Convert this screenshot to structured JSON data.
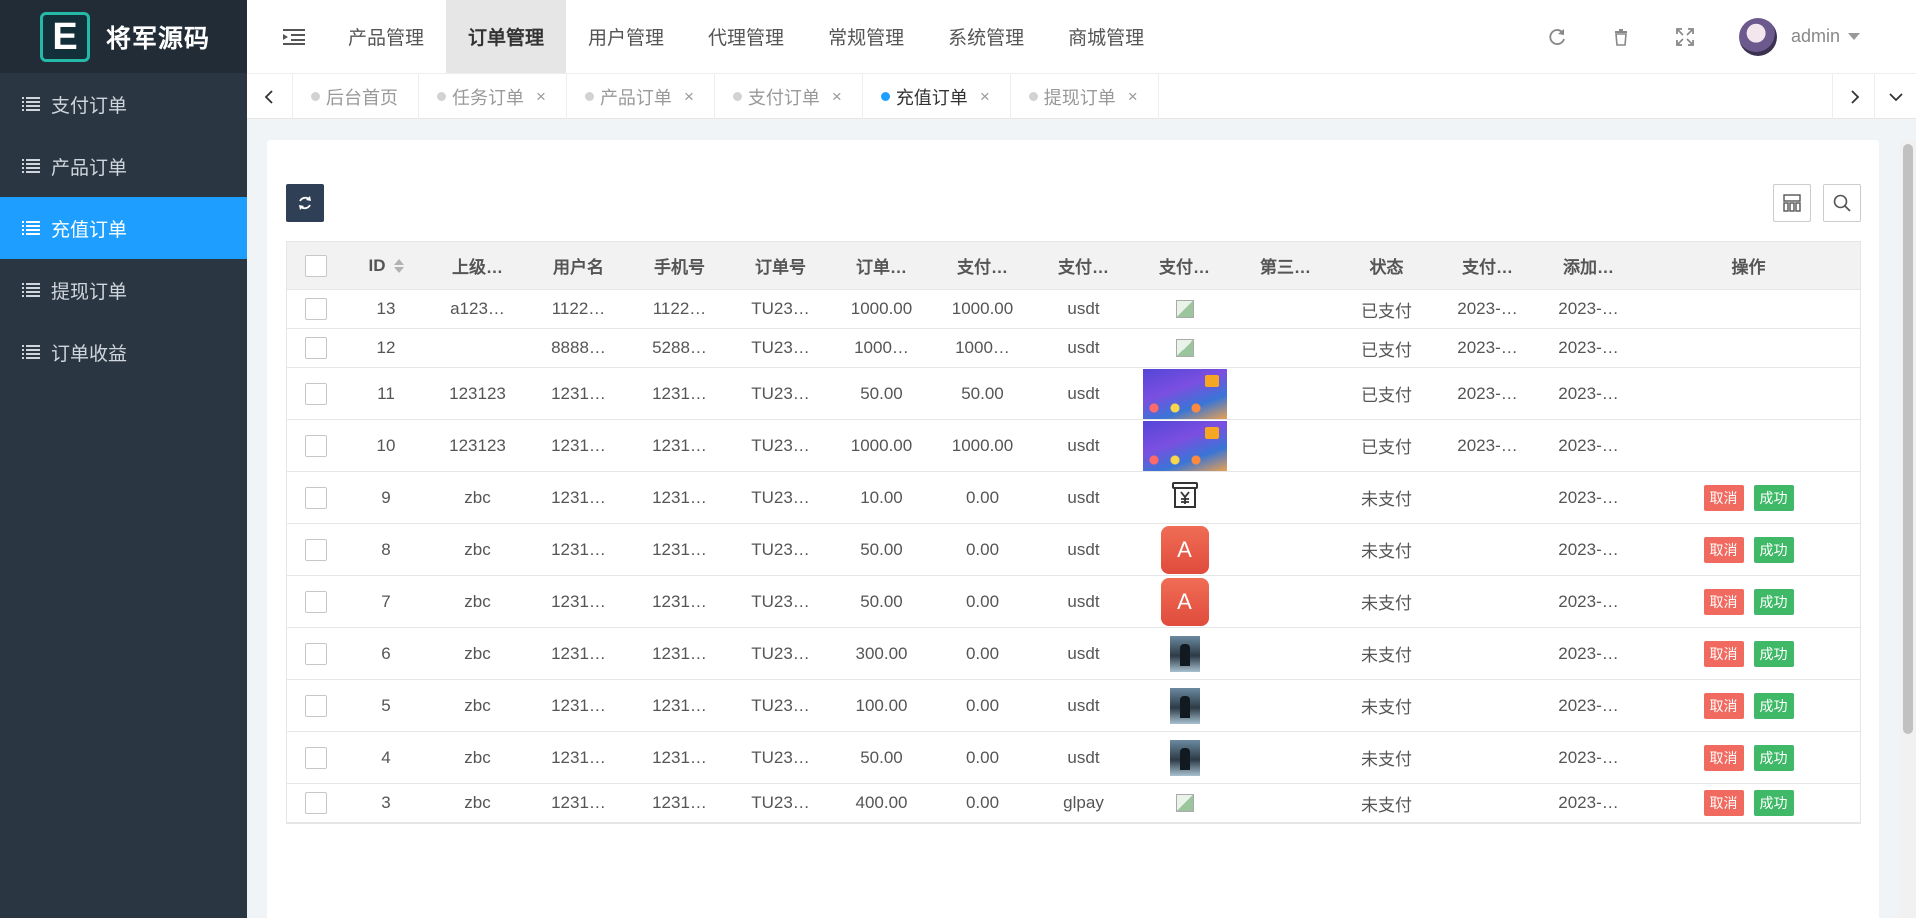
{
  "brand": {
    "letter": "E",
    "name": "将军源码"
  },
  "sidebar": {
    "items": [
      {
        "label": "支付订单",
        "active": false
      },
      {
        "label": "产品订单",
        "active": false
      },
      {
        "label": "充值订单",
        "active": true
      },
      {
        "label": "提现订单",
        "active": false
      },
      {
        "label": "订单收益",
        "active": false
      }
    ]
  },
  "topnav": {
    "items": [
      {
        "label": "产品管理",
        "active": false
      },
      {
        "label": "订单管理",
        "active": true
      },
      {
        "label": "用户管理",
        "active": false
      },
      {
        "label": "代理管理",
        "active": false
      },
      {
        "label": "常规管理",
        "active": false
      },
      {
        "label": "系统管理",
        "active": false
      },
      {
        "label": "商城管理",
        "active": false
      }
    ],
    "username": "admin",
    "tools": [
      "refresh-icon",
      "trash-icon",
      "fullscreen-icon"
    ]
  },
  "tabs": [
    {
      "label": "后台首页",
      "closable": false,
      "active": false
    },
    {
      "label": "任务订单",
      "closable": true,
      "active": false
    },
    {
      "label": "产品订单",
      "closable": true,
      "active": false
    },
    {
      "label": "支付订单",
      "closable": true,
      "active": false
    },
    {
      "label": "充值订单",
      "closable": true,
      "active": true
    },
    {
      "label": "提现订单",
      "closable": true,
      "active": false
    }
  ],
  "table": {
    "headers": {
      "id": "ID",
      "parent": "上级…",
      "user": "用户名",
      "phone": "手机号",
      "order": "订单号",
      "amount": "订单…",
      "paid": "支付…",
      "paytype": "支付…",
      "image": "支付…",
      "third": "第三…",
      "status": "状态",
      "paytime": "支付…",
      "addtime": "添加…",
      "ops": "操作"
    },
    "actions": {
      "cancel": "取消",
      "success": "成功"
    },
    "rows": [
      {
        "id": "13",
        "parent": "a123…",
        "user": "1122…",
        "phone": "1122…",
        "order": "TU23…",
        "amount": "1000.00",
        "paid": "1000.00",
        "paytype": "usdt",
        "thumb": "broken",
        "third": "",
        "status": "已支付",
        "paytime": "2023-…",
        "addtime": "2023-…",
        "ops": false
      },
      {
        "id": "12",
        "parent": "",
        "user": "8888…",
        "phone": "5288…",
        "order": "TU23…",
        "amount": "1000…",
        "paid": "1000…",
        "paytype": "usdt",
        "thumb": "broken",
        "third": "",
        "status": "已支付",
        "paytime": "2023-…",
        "addtime": "2023-…",
        "ops": false
      },
      {
        "id": "11",
        "parent": "123123",
        "user": "1231…",
        "phone": "1231…",
        "order": "TU23…",
        "amount": "50.00",
        "paid": "50.00",
        "paytype": "usdt",
        "thumb": "banner",
        "third": "",
        "status": "已支付",
        "paytime": "2023-…",
        "addtime": "2023-…",
        "ops": false
      },
      {
        "id": "10",
        "parent": "123123",
        "user": "1231…",
        "phone": "1231…",
        "order": "TU23…",
        "amount": "1000.00",
        "paid": "1000.00",
        "paytype": "usdt",
        "thumb": "banner",
        "third": "",
        "status": "已支付",
        "paytime": "2023-…",
        "addtime": "2023-…",
        "ops": false
      },
      {
        "id": "9",
        "parent": "zbc",
        "user": "1231…",
        "phone": "1231…",
        "order": "TU23…",
        "amount": "10.00",
        "paid": "0.00",
        "paytype": "usdt",
        "thumb": "yen",
        "third": "",
        "status": "未支付",
        "paytime": "",
        "addtime": "2023-…",
        "ops": true
      },
      {
        "id": "8",
        "parent": "zbc",
        "user": "1231…",
        "phone": "1231…",
        "order": "TU23…",
        "amount": "50.00",
        "paid": "0.00",
        "paytype": "usdt",
        "thumb": "appA",
        "third": "",
        "status": "未支付",
        "paytime": "",
        "addtime": "2023-…",
        "ops": true
      },
      {
        "id": "7",
        "parent": "zbc",
        "user": "1231…",
        "phone": "1231…",
        "order": "TU23…",
        "amount": "50.00",
        "paid": "0.00",
        "paytype": "usdt",
        "thumb": "appA",
        "third": "",
        "status": "未支付",
        "paytime": "",
        "addtime": "2023-…",
        "ops": true
      },
      {
        "id": "6",
        "parent": "zbc",
        "user": "1231…",
        "phone": "1231…",
        "order": "TU23…",
        "amount": "300.00",
        "paid": "0.00",
        "paytype": "usdt",
        "thumb": "photo",
        "third": "",
        "status": "未支付",
        "paytime": "",
        "addtime": "2023-…",
        "ops": true
      },
      {
        "id": "5",
        "parent": "zbc",
        "user": "1231…",
        "phone": "1231…",
        "order": "TU23…",
        "amount": "100.00",
        "paid": "0.00",
        "paytype": "usdt",
        "thumb": "photo",
        "third": "",
        "status": "未支付",
        "paytime": "",
        "addtime": "2023-…",
        "ops": true
      },
      {
        "id": "4",
        "parent": "zbc",
        "user": "1231…",
        "phone": "1231…",
        "order": "TU23…",
        "amount": "50.00",
        "paid": "0.00",
        "paytype": "usdt",
        "thumb": "photo",
        "third": "",
        "status": "未支付",
        "paytime": "",
        "addtime": "2023-…",
        "ops": true
      },
      {
        "id": "3",
        "parent": "zbc",
        "user": "1231…",
        "phone": "1231…",
        "order": "TU23…",
        "amount": "400.00",
        "paid": "0.00",
        "paytype": "glpay",
        "thumb": "broken",
        "third": "",
        "status": "未支付",
        "paytime": "",
        "addtime": "2023-…",
        "ops": true
      }
    ]
  },
  "colors": {
    "sidebar_bg": "#2b3643",
    "accent": "#1e9fff",
    "cancel": "#f06a5f",
    "success": "#3fb967"
  }
}
